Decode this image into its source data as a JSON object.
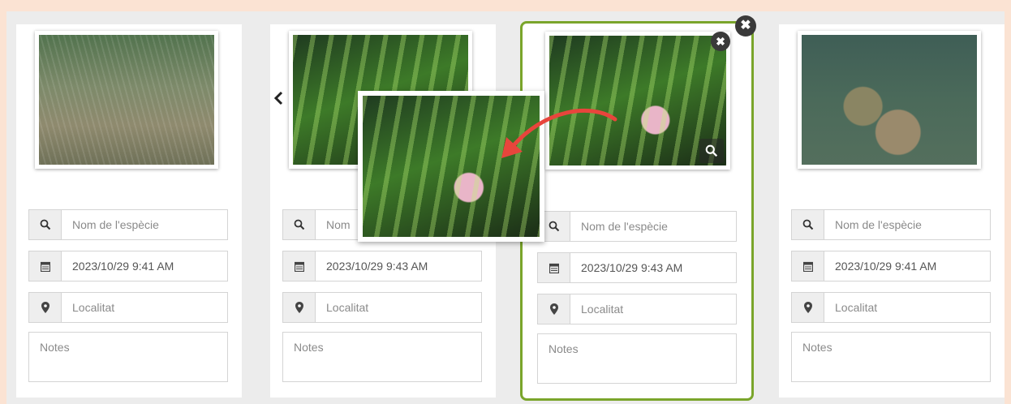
{
  "cards": [
    {
      "species_placeholder": "Nom de l'espècie",
      "datetime": "2023/10/29 9:41 AM",
      "location_placeholder": "Localitat",
      "notes_placeholder": "Notes"
    },
    {
      "species_placeholder": "Nom",
      "datetime": "2023/10/29 9:43 AM",
      "location_placeholder": "Localitat",
      "notes_placeholder": "Notes"
    },
    {
      "species_placeholder": "Nom de l'espècie",
      "datetime": "2023/10/29 9:43 AM",
      "location_placeholder": "Localitat",
      "notes_placeholder": "Notes"
    },
    {
      "species_placeholder": "Nom de l'espècie",
      "datetime": "2023/10/29 9:41 AM",
      "location_placeholder": "Localitat",
      "notes_placeholder": "Notes"
    }
  ],
  "close_glyph": "✖",
  "colors": {
    "background": "#fbe3d3",
    "panel": "#ececec",
    "selected_border": "#7aa52b",
    "arrow": "#e8453c"
  },
  "icons": [
    "search-icon",
    "calendar-icon",
    "map-marker-icon",
    "close-icon",
    "zoom-icon",
    "chevron-left-icon",
    "drag-arrow-icon"
  ]
}
